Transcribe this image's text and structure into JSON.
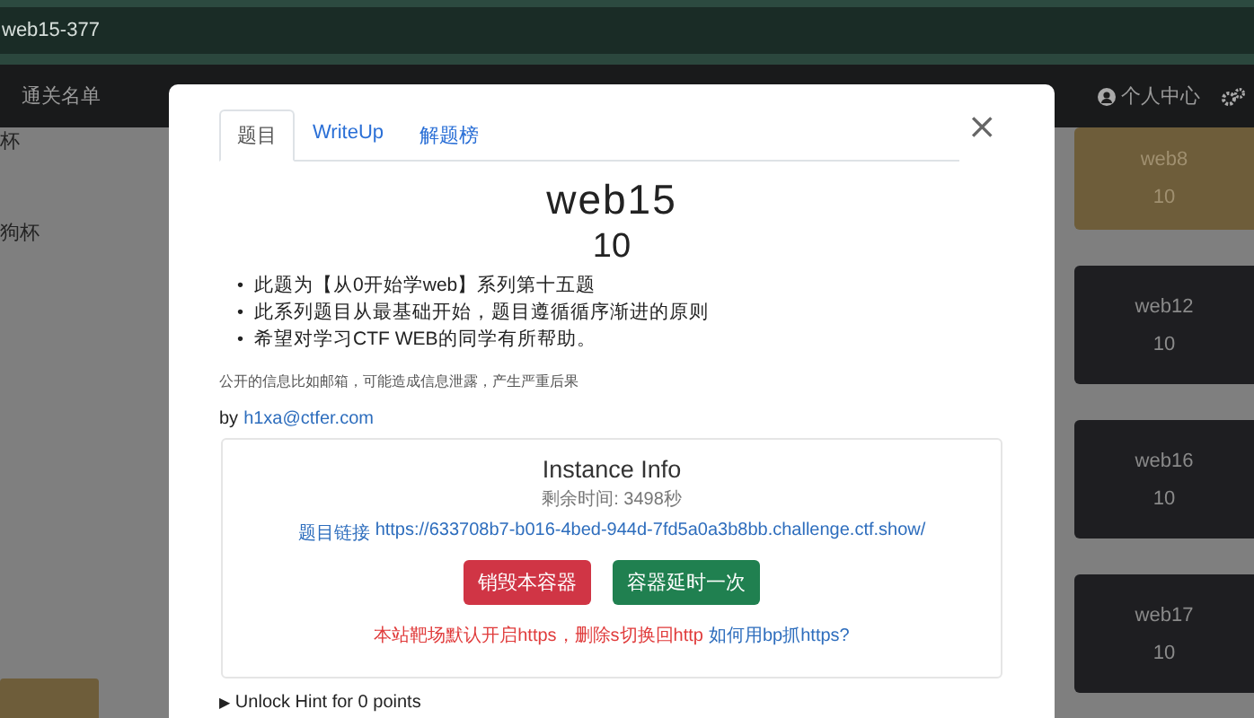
{
  "window": {
    "title": "web15-377"
  },
  "nav": {
    "items": [
      {
        "label": "通关名单"
      }
    ],
    "right": [
      {
        "label": "个人中心"
      }
    ]
  },
  "left_list": [
    {
      "label": "杯"
    },
    {
      "label": "狗杯"
    }
  ],
  "cards": [
    {
      "name": "web8",
      "score": "10",
      "solved": true
    },
    {
      "name": "web12",
      "score": "10",
      "solved": false
    },
    {
      "name": "web16",
      "score": "10",
      "solved": false
    },
    {
      "name": "web17",
      "score": "10",
      "solved": false
    }
  ],
  "modal": {
    "tabs": [
      {
        "label": "题目",
        "selected": true
      },
      {
        "label": "WriteUp",
        "selected": false
      },
      {
        "label": "解题榜",
        "selected": false
      }
    ],
    "close": "×",
    "title": "web15",
    "points": "10",
    "bullets": [
      {
        "marker": "•",
        "text": "此题为【从0开始学web】系列第十五题"
      },
      {
        "marker": "•",
        "text": "此系列题目从最基础开始，题目遵循循序渐进的原则"
      },
      {
        "marker": "•",
        "text": "希望对学习CTF WEB的同学有所帮助。"
      }
    ],
    "hint_text": "公开的信息比如邮箱，可能造成信息泄露，产生严重后果",
    "author_prefix": "by",
    "author": "h1xa@ctfer.com",
    "instance": {
      "title": "Instance Info",
      "remaining": "剩余时间: 3498秒",
      "link_label": "题目链接",
      "link": "https://633708b7-b016-4bed-944d-7fd5a0a3b8bb.challenge.ctf.show/",
      "buttons": [
        {
          "label": "销毁本容器",
          "kind": "danger"
        },
        {
          "label": "容器延时一次",
          "kind": "success"
        }
      ],
      "note": "本站靶场默认开启https，删除s切换回http",
      "note_link": "如何用bp抓https?"
    },
    "unlock": {
      "arrow": "▶",
      "label": "Unlock Hint for 0 points"
    }
  }
}
